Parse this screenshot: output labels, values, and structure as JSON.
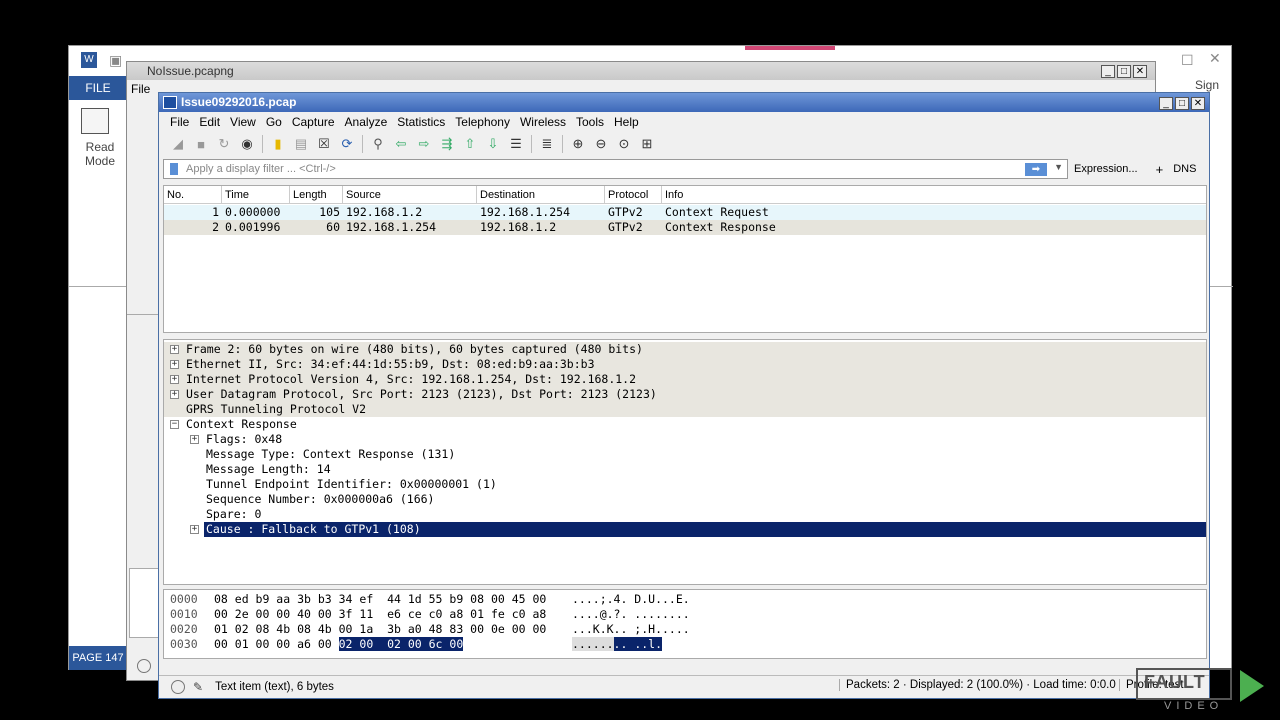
{
  "word": {
    "file_label": "FILE",
    "read_mode_label": "Read Mode",
    "status_label": "PAGE 147",
    "signin_label": "Sign in"
  },
  "noissue_window": {
    "title": "NoIssue.pcapng"
  },
  "window": {
    "title": "Issue09292016.pcap"
  },
  "menu": [
    "File",
    "Edit",
    "View",
    "Go",
    "Capture",
    "Analyze",
    "Statistics",
    "Telephony",
    "Wireless",
    "Tools",
    "Help"
  ],
  "filter": {
    "placeholder": "Apply a display filter ... <Ctrl-/>",
    "expression_label": "Expression...",
    "plus_label": "+",
    "dns_label": "DNS"
  },
  "packet_list": {
    "columns": [
      "No.",
      "Time",
      "Length",
      "Source",
      "Destination",
      "Protocol",
      "Info"
    ],
    "rows": [
      {
        "no": "1",
        "time": "0.000000",
        "length": "105",
        "source": "192.168.1.2",
        "destination": "192.168.1.254",
        "protocol": "GTPv2",
        "info": "Context Request"
      },
      {
        "no": "2",
        "time": "0.001996",
        "length": "60",
        "source": "192.168.1.254",
        "destination": "192.168.1.2",
        "protocol": "GTPv2",
        "info": "Context Response"
      }
    ]
  },
  "details": [
    "Frame 2: 60 bytes on wire (480 bits), 60 bytes captured (480 bits)",
    "Ethernet II, Src: 34:ef:44:1d:55:b9, Dst: 08:ed:b9:aa:3b:b3",
    "Internet Protocol Version 4, Src: 192.168.1.254, Dst: 192.168.1.2",
    "User Datagram Protocol, Src Port: 2123 (2123), Dst Port: 2123 (2123)",
    "GPRS Tunneling Protocol V2",
    "Context Response",
    "Flags: 0x48",
    "Message Type: Context Response (131)",
    "Message Length: 14",
    "Tunnel Endpoint Identifier: 0x00000001 (1)",
    "Sequence Number: 0x000000a6 (166)",
    "Spare: 0",
    "Cause : Fallback to GTPv1 (108)"
  ],
  "bytes": [
    {
      "offset": "0000",
      "hex": "08 ed b9 aa 3b b3 34 ef  44 1d 55 b9 08 00 45 00",
      "ascii": "....;.4. D.U...E."
    },
    {
      "offset": "0010",
      "hex": "00 2e 00 00 40 00 3f 11  e6 ce c0 a8 01 fe c0 a8",
      "ascii": "....@.?. ........"
    },
    {
      "offset": "0020",
      "hex": "01 02 08 4b 08 4b 00 1a  3b a0 48 83 00 0e 00 00",
      "ascii": "...K.K.. ;.H....."
    },
    {
      "offset": "0030",
      "hex_plain": "00 01 00 00 a6 00 ",
      "hex_hl": "02 00  02 00 6c 00",
      "ascii_plain": "......",
      "ascii_hl": ".. ..l."
    }
  ],
  "status": {
    "text": "Text item (text), 6 bytes",
    "packets": "Packets: 2 · Displayed: 2 (100.0%) · Load time: 0:0.0",
    "profile": "Profile: test"
  },
  "watermark": {
    "brand": "FAULT",
    "sub": "VIDEO"
  },
  "colors": {
    "title_blue": "#3d68b8",
    "selection": "#0a246a",
    "word_blue": "#2b579a"
  }
}
